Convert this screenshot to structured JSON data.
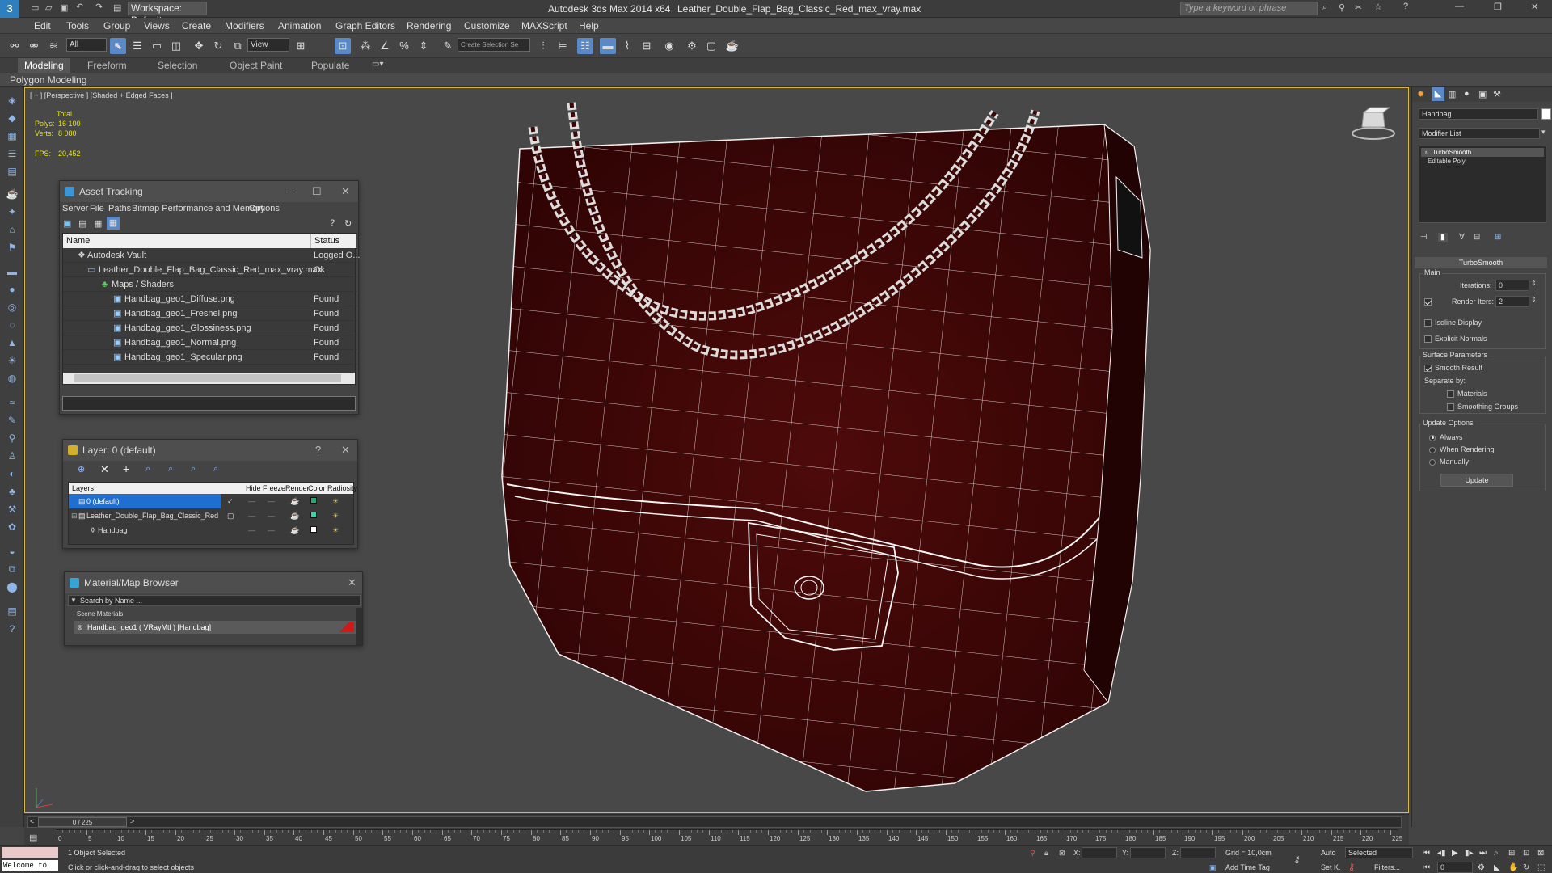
{
  "titlebar": {
    "workspace_label": "Workspace: Default",
    "app_title": "Autodesk 3ds Max  2014 x64",
    "file_title": "Leather_Double_Flap_Bag_Classic_Red_max_vray.max",
    "search_placeholder": "Type a keyword or phrase"
  },
  "menu": [
    "Edit",
    "Tools",
    "Group",
    "Views",
    "Create",
    "Modifiers",
    "Animation",
    "Graph Editors",
    "Rendering",
    "Customize",
    "MAXScript",
    "Help"
  ],
  "toolbar": {
    "filter_value": "All",
    "refcoord_value": "View",
    "named_sel_value": "Create Selection Se"
  },
  "ribbon": {
    "tabs": [
      "Modeling",
      "Freeform",
      "Selection",
      "Object Paint",
      "Populate"
    ],
    "sub_label": "Polygon Modeling"
  },
  "viewport": {
    "label": "[ + ] [Perspective ] [Shaded + Edged Faces ]",
    "total_label": "Total",
    "polys_label": "Polys:",
    "polys_value": "16 100",
    "verts_label": "Verts:",
    "verts_value": "8 080",
    "fps_label": "FPS:",
    "fps_value": "20,452"
  },
  "asset_tracking": {
    "title": "Asset Tracking",
    "menu": [
      "Server",
      "File",
      "Paths",
      "Bitmap Performance and Memory",
      "Options"
    ],
    "col_name": "Name",
    "col_status": "Status",
    "rows": [
      {
        "name": "Autodesk Vault",
        "status": "Logged O..."
      },
      {
        "name": "Leather_Double_Flap_Bag_Classic_Red_max_vray.max",
        "status": "Ok"
      },
      {
        "name": "Maps / Shaders",
        "status": ""
      },
      {
        "name": "Handbag_geo1_Diffuse.png",
        "status": "Found"
      },
      {
        "name": "Handbag_geo1_Fresnel.png",
        "status": "Found"
      },
      {
        "name": "Handbag_geo1_Glossiness.png",
        "status": "Found"
      },
      {
        "name": "Handbag_geo1_Normal.png",
        "status": "Found"
      },
      {
        "name": "Handbag_geo1_Specular.png",
        "status": "Found"
      }
    ]
  },
  "layer_panel": {
    "title": "Layer: 0 (default)",
    "help": "?",
    "cols": [
      "Layers",
      "Hide",
      "Freeze",
      "Render",
      "Color",
      "Radiosity"
    ],
    "rows": [
      {
        "name": "0 (default)"
      },
      {
        "name": "Leather_Double_Flap_Bag_Classic_Red"
      },
      {
        "name": "Handbag"
      }
    ]
  },
  "material_browser": {
    "title": "Material/Map Browser",
    "search_placeholder": "Search by Name ...",
    "section": "- Scene Materials",
    "item": "Handbag_geo1  ( VRayMtl )  [Handbag]"
  },
  "command_panel": {
    "object_name": "Handbag",
    "modifier_list": "Modifier List",
    "stack": [
      "TurboSmooth",
      "Editable Poly"
    ],
    "rollout_title": "TurboSmooth",
    "main_label": "Main",
    "iterations_label": "Iterations:",
    "iterations_value": "0",
    "render_iters_label": "Render Iters:",
    "render_iters_value": "2",
    "isoline_label": "Isoline Display",
    "explicit_normals_label": "Explicit Normals",
    "surface_params_label": "Surface Parameters",
    "smooth_result_label": "Smooth Result",
    "separate_by_label": "Separate by:",
    "materials_label": "Materials",
    "smoothing_groups_label": "Smoothing Groups",
    "update_options_label": "Update Options",
    "always_label": "Always",
    "when_rendering_label": "When Rendering",
    "manually_label": "Manually",
    "update_button": "Update"
  },
  "timeline": {
    "frame_label": "0 / 225",
    "ticks": [
      "0",
      "5",
      "10",
      "15",
      "20",
      "25",
      "30",
      "35",
      "40",
      "45",
      "50",
      "55",
      "60",
      "65",
      "70",
      "75",
      "80",
      "85",
      "90",
      "95",
      "100",
      "105",
      "110",
      "115",
      "120",
      "125",
      "130",
      "135",
      "140",
      "145",
      "150",
      "155",
      "160",
      "165",
      "170",
      "175",
      "180",
      "185",
      "190",
      "195",
      "200",
      "205",
      "210",
      "215",
      "220",
      "225"
    ]
  },
  "status": {
    "welcome": "Welcome to",
    "selected": "1 Object Selected",
    "hint": "Click or click-and-drag to select objects",
    "x_label": "X:",
    "y_label": "Y:",
    "z_label": "Z:",
    "grid": "Grid = 10,0cm",
    "auto": "Auto",
    "selected_dropdown": "Selected",
    "set_key": "Set K.",
    "filters": "Filters...",
    "add_time_tag": "Add Time Tag",
    "frame_value": "0"
  },
  "colors": {
    "accent": "#5a89c8",
    "viewport_border": "#d6b84a",
    "bag": "#4a0808",
    "stat": "#e6e600"
  }
}
